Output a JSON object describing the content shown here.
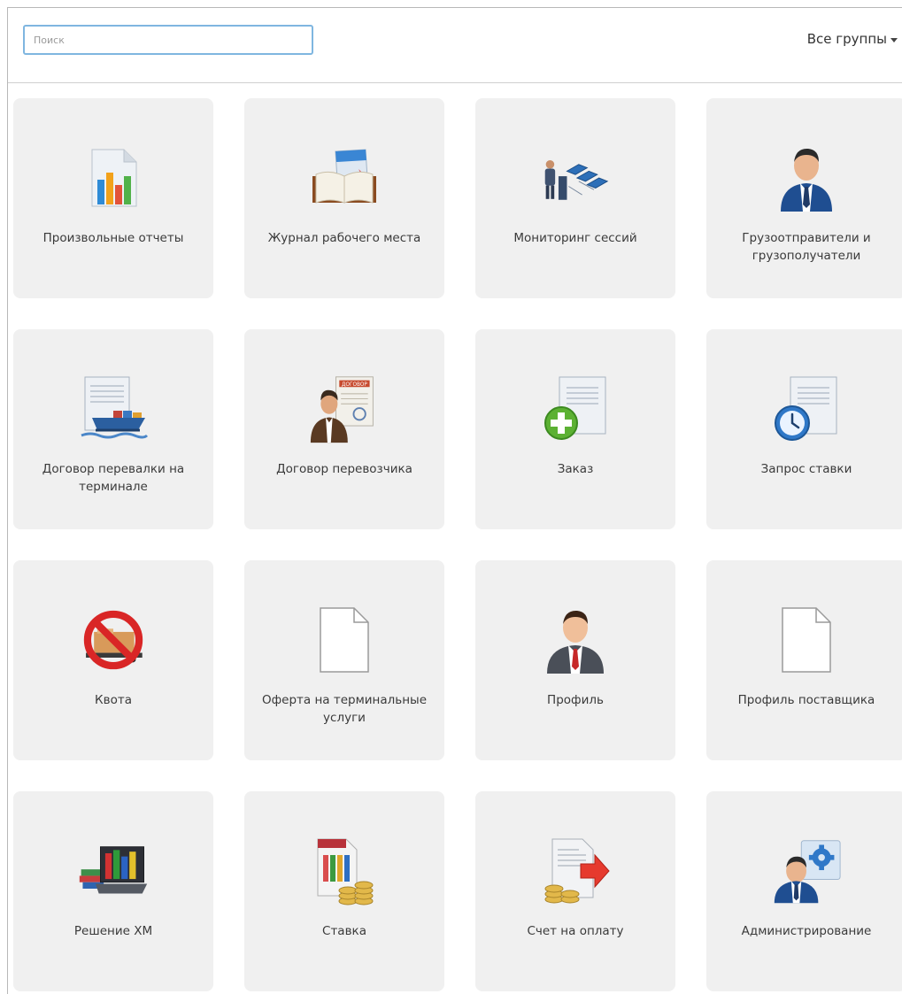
{
  "search": {
    "placeholder": "Поиск",
    "value": ""
  },
  "groups_label": "Все группы",
  "tiles": [
    {
      "label": "Произвольные отчеты",
      "icon": "report-chart-icon"
    },
    {
      "label": "Журнал рабочего места",
      "icon": "journal-book-icon"
    },
    {
      "label": "Мониторинг сессий",
      "icon": "session-monitor-icon"
    },
    {
      "label": "Грузоотправители и грузополучатели",
      "icon": "shipper-person-icon"
    },
    {
      "label": "Договор перевалки на терминале",
      "icon": "terminal-contract-ship-icon"
    },
    {
      "label": "Договор перевозчика",
      "icon": "carrier-contract-icon"
    },
    {
      "label": "Заказ",
      "icon": "order-add-icon"
    },
    {
      "label": "Запрос ставки",
      "icon": "rate-request-clock-icon"
    },
    {
      "label": "Квота",
      "icon": "quota-prohibited-icon"
    },
    {
      "label": "Оферта на терминальные услуги",
      "icon": "blank-document-icon"
    },
    {
      "label": "Профиль",
      "icon": "profile-person-icon"
    },
    {
      "label": "Профиль поставщика",
      "icon": "blank-document-icon"
    },
    {
      "label": "Решение ХМ",
      "icon": "decision-laptop-chart-icon"
    },
    {
      "label": "Ставка",
      "icon": "rate-coins-icon"
    },
    {
      "label": "Счет на оплату",
      "icon": "invoice-coins-icon"
    },
    {
      "label": "Администрирование",
      "icon": "admin-gear-person-icon"
    }
  ]
}
